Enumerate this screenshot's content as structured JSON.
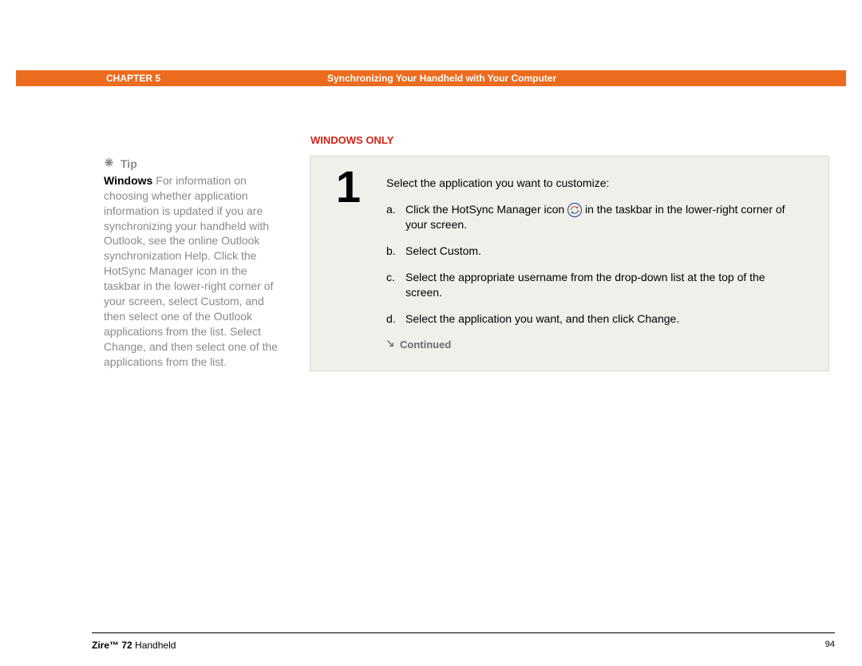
{
  "header": {
    "chapter": "CHAPTER 5",
    "title": "Synchronizing Your Handheld with Your Computer"
  },
  "sidebar": {
    "tip_label": "Tip",
    "tip_bold": "Windows",
    "tip_body": " For information on choosing whether application information is updated if you are synchronizing your handheld with Outlook, see the online Outlook synchronization Help. Click the HotSync Manager icon in the taskbar in the lower-right corner of your screen, select Custom, and then select one of the Outlook applications from the list. Select Change, and then select one of the applications from the list."
  },
  "section_label": "WINDOWS ONLY",
  "step": {
    "number": "1",
    "intro": "Select the application you want to customize:",
    "a_pre": "Click the HotSync Manager icon ",
    "a_post": " in the taskbar in the lower-right corner of your screen.",
    "b": "Select Custom.",
    "c": "Select the appropriate username from the drop-down list at the top of the screen.",
    "d": "Select the application you want, and then click Change.",
    "continued": "Continued"
  },
  "footer": {
    "brand": "Zire™ 72",
    "rest": " Handheld",
    "page": "94"
  }
}
